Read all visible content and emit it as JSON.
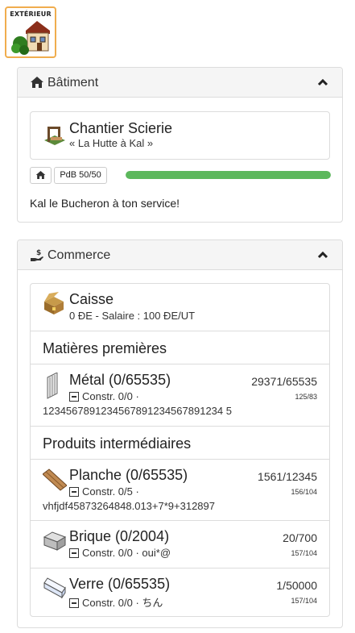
{
  "exterior_button": {
    "label": "EXTÉRIEUR"
  },
  "batiment": {
    "header": "Bâtiment",
    "card_title": "Chantier Scierie",
    "card_subtitle": "« La Hutte à Kal »",
    "pdb_label": "PdB 50/50",
    "pdb_fraction": 1.0,
    "greeting": "Kal le Bucheron à ton service!"
  },
  "commerce": {
    "header": "Commerce",
    "caisse": {
      "title": "Caisse",
      "subtitle": "0 ÐE - Salaire : 100 ÐE/UT"
    },
    "heading_raw": "Matières premières",
    "heading_inter": "Produits intermédiaires",
    "items": [
      {
        "name": "Métal (0/65535)",
        "constr": "Constr. 0/0 ·",
        "extra": "1234567891234567891234567891234 5",
        "qty": "29371/65535",
        "small": "125/83",
        "icon": "metal-icon"
      },
      {
        "name": "Planche (0/65535)",
        "constr": "Constr. 0/5 ·",
        "extra": "vhfjdf45873264848.013+7*9+312897",
        "qty": "1561/12345",
        "small": "156/104",
        "icon": "plank-icon"
      },
      {
        "name": "Brique (0/2004)",
        "constr": "Constr. 0/0 · oui*@",
        "qty": "20/700",
        "small": "157/104",
        "icon": "brick-icon"
      },
      {
        "name": "Verre (0/65535)",
        "constr": "Constr. 0/0 · ちん",
        "qty": "1/50000",
        "small": "157/104",
        "icon": "glass-icon"
      }
    ]
  },
  "colors": {
    "accent": "#f0ad4e",
    "progress": "#5cb85c",
    "panel_bg": "#f5f5f5"
  }
}
